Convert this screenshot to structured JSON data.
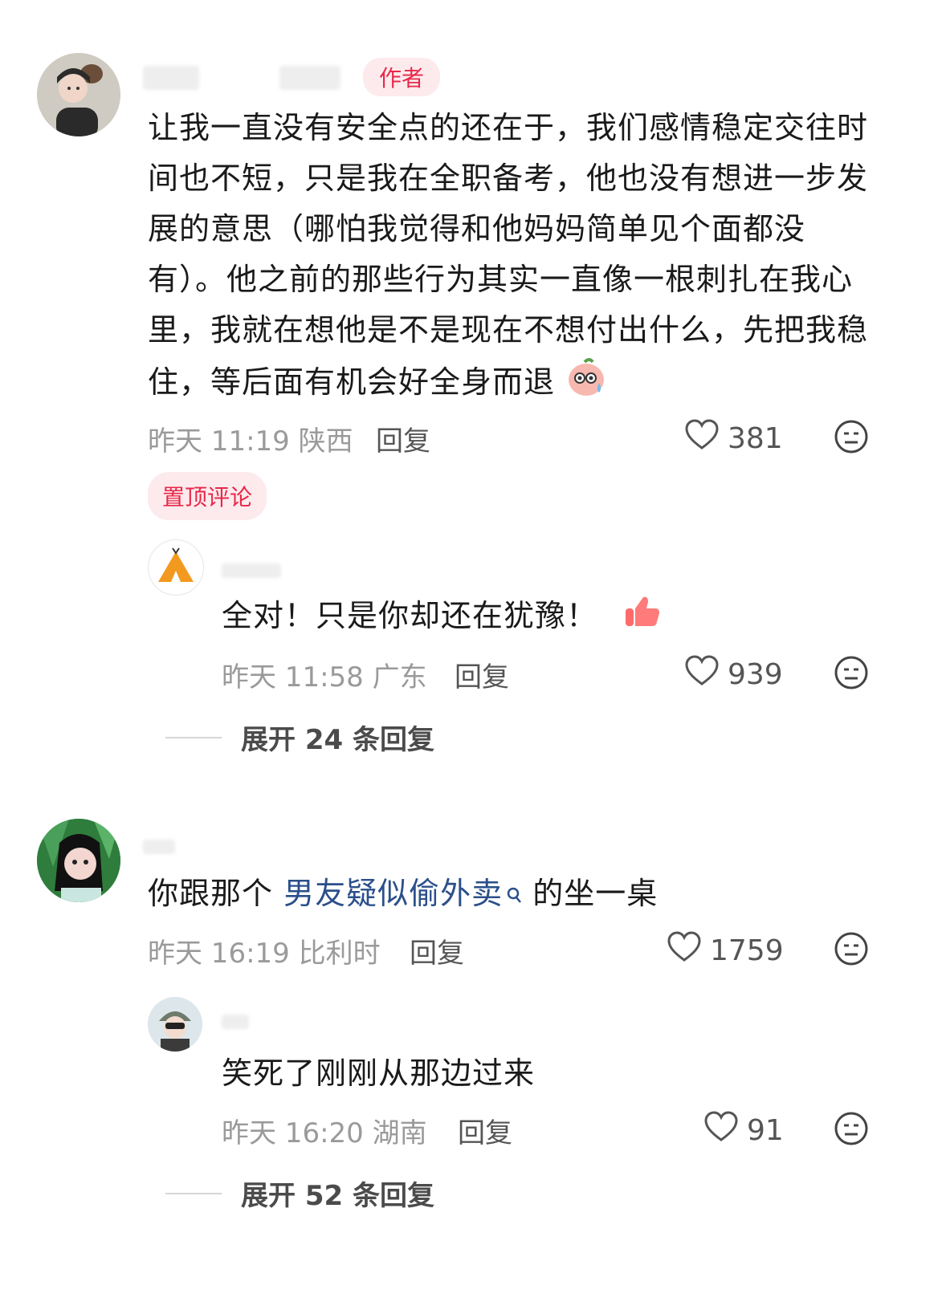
{
  "comments": [
    {
      "author_tag": "作者",
      "text": "让我一直没有安全点的还在于，我们感情稳定交往时间也不短，只是我在全职备考，他也没有想进一步发展的意思（哪怕我觉得和他妈妈简单见个面都没有）。他之前的那些行为其实一直像一根刺扎在我心里，我就在想他是不是现在不想付出什么，先把我稳住，等后面有机会好全身而退",
      "meta": "昨天 11:19 陕西",
      "reply_label": "回复",
      "likes": "381",
      "pinned_label": "置顶评论",
      "sub_reply": {
        "text": "全对！只是你却还在犹豫！",
        "meta": "昨天 11:58 广东",
        "reply_label": "回复",
        "likes": "939"
      },
      "expand_label": "展开 24 条回复"
    },
    {
      "text_before": "你跟那个",
      "search_link": "男友疑似偷外卖",
      "text_after": "的坐一桌",
      "meta": "昨天 16:19 比利时",
      "reply_label": "回复",
      "likes": "1759",
      "sub_reply": {
        "text": "笑死了刚刚从那边过来",
        "meta": "昨天 16:20 湖南",
        "reply_label": "回复",
        "likes": "91"
      },
      "expand_label": "展开 52 条回复"
    }
  ],
  "icons": {
    "like": "heart-outline-icon",
    "dislike": "neutral-face-icon",
    "search": "search-icon",
    "emoji_sweat": "sweating-emoji-icon",
    "emoji_thumb": "thumbs-up-emoji-icon"
  },
  "colors": {
    "accent": "#e8284a",
    "link": "#2b4f8a",
    "meta": "#9a9a9a"
  }
}
